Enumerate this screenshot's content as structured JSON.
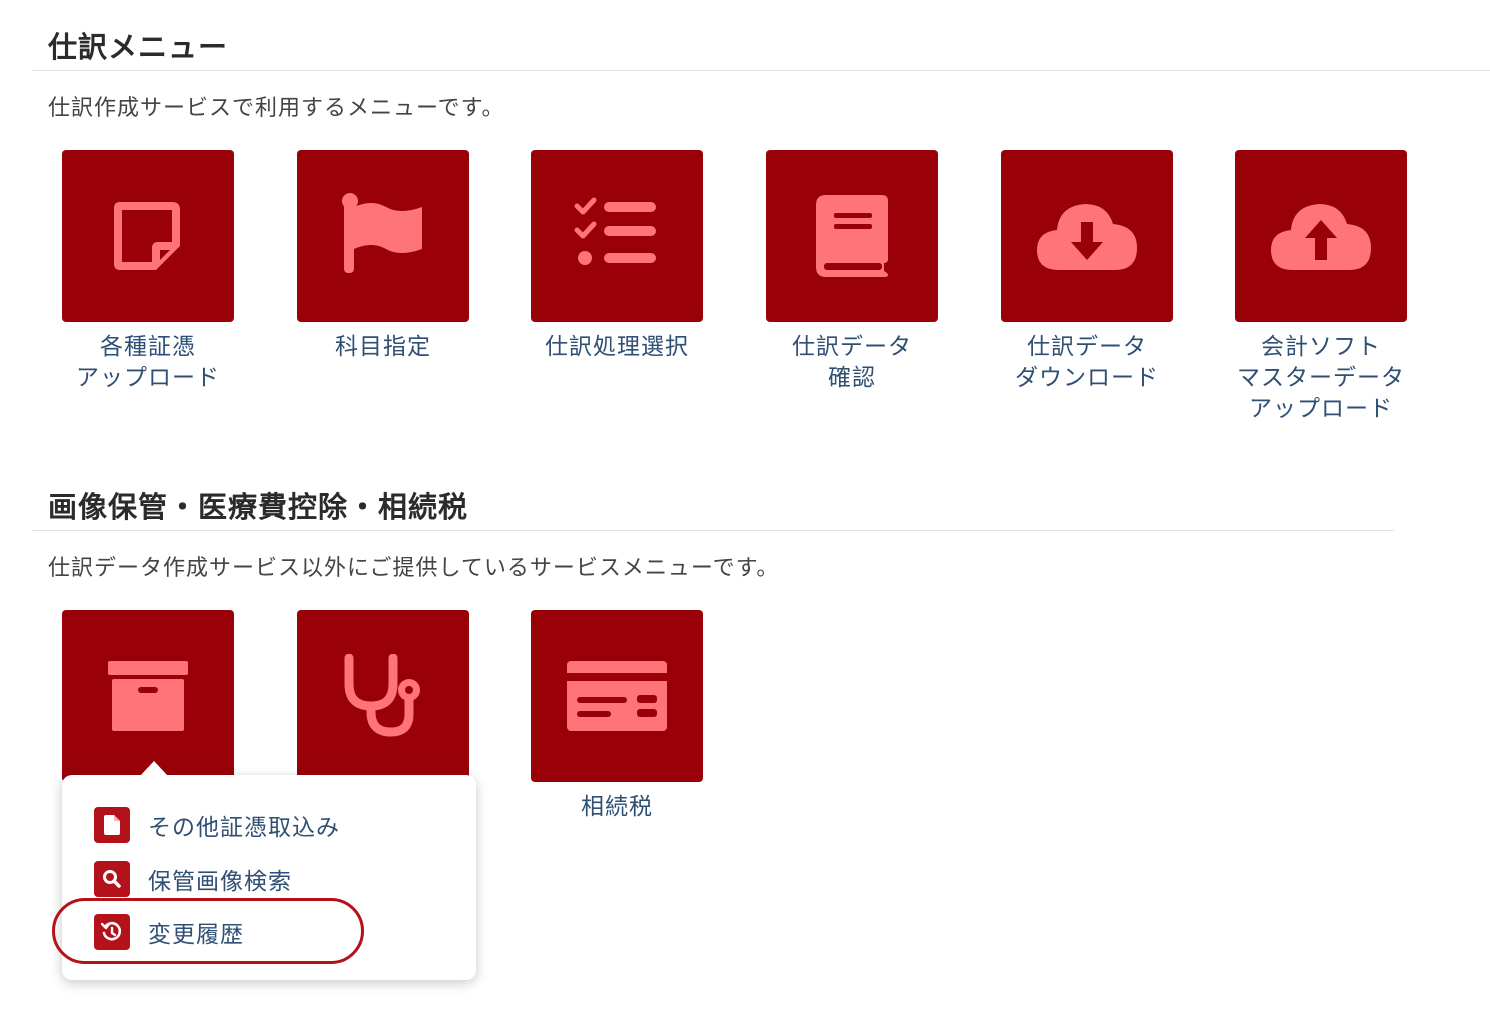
{
  "section1": {
    "title": "仕訳メニュー",
    "description": "仕訳作成サービスで利用するメニューです。",
    "tiles": [
      {
        "label": "各種証憑\nアップロード",
        "icon": "sticky-note-icon"
      },
      {
        "label": "科目指定",
        "icon": "flag-icon"
      },
      {
        "label": "仕訳処理選択",
        "icon": "checklist-icon"
      },
      {
        "label": "仕訳データ\n確認",
        "icon": "book-icon"
      },
      {
        "label": "仕訳データ\nダウンロード",
        "icon": "cloud-download-icon"
      },
      {
        "label": "会計ソフト\nマスターデータ\nアップロード",
        "icon": "cloud-upload-icon"
      }
    ]
  },
  "section2": {
    "title": "画像保管・医療費控除・相続税",
    "description": "仕訳データ作成サービス以外にご提供しているサービスメニューです。",
    "tiles": [
      {
        "label": "",
        "icon": "archive-box-icon"
      },
      {
        "label": "",
        "icon": "stethoscope-icon"
      },
      {
        "label": "相続税",
        "icon": "id-card-icon"
      }
    ]
  },
  "popup": {
    "items": [
      {
        "label": "その他証憑取込み",
        "icon": "file-icon"
      },
      {
        "label": "保管画像検索",
        "icon": "search-icon"
      },
      {
        "label": "変更履歴",
        "icon": "history-icon"
      }
    ]
  },
  "colors": {
    "tile_bg": "#990008",
    "icon_fill": "#ff7478",
    "label_text": "#2f4f74",
    "popup_icon_bg": "#b3121b",
    "highlight": "#b3121b"
  }
}
